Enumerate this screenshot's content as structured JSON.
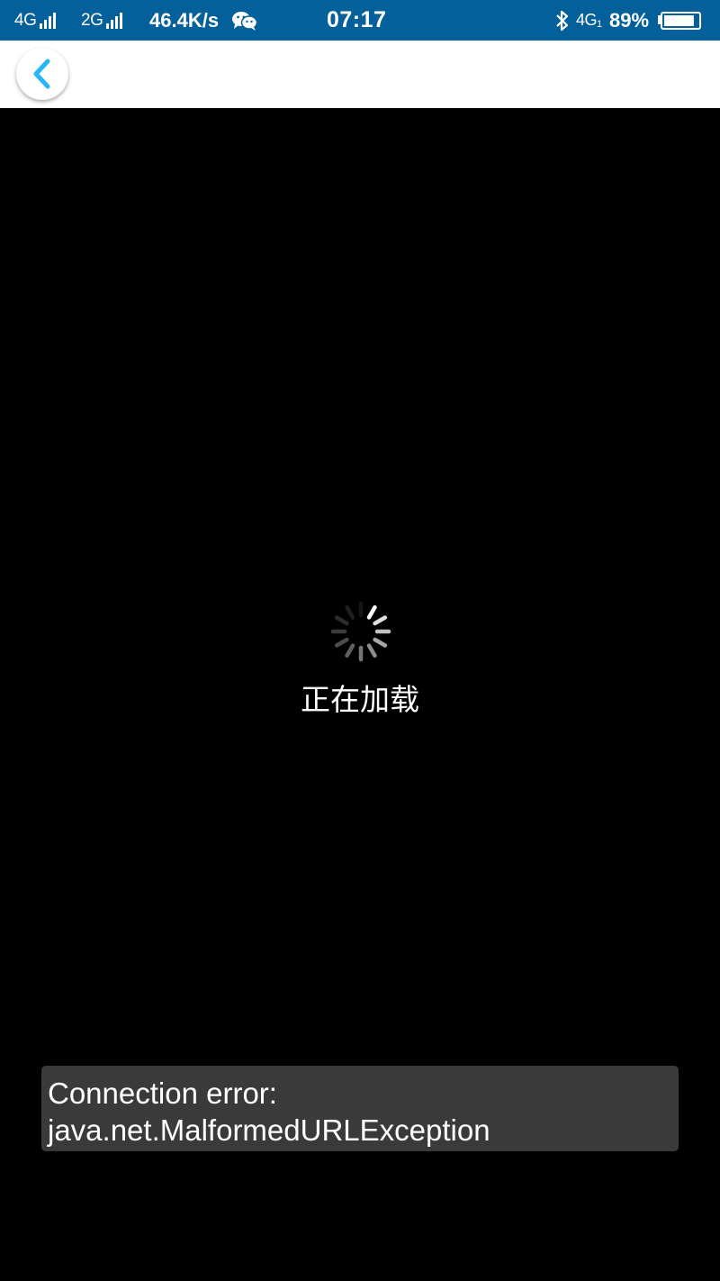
{
  "status_bar": {
    "network_1": "4G",
    "network_2": "2G",
    "speed": "46.4K/s",
    "time": "07:17",
    "data_network": "4G",
    "data_sim": "1",
    "battery": "89%",
    "battery_level": 0.89,
    "icons": [
      "signal-icon",
      "wechat-icon",
      "bluetooth-icon",
      "battery-icon"
    ]
  },
  "header": {
    "back_icon": "chevron-left-icon",
    "accent_color": "#29b6f6"
  },
  "main": {
    "loading_text": "正在加载"
  },
  "toast": {
    "line1": "Connection error:",
    "line2": "java.net.MalformedURLException"
  }
}
